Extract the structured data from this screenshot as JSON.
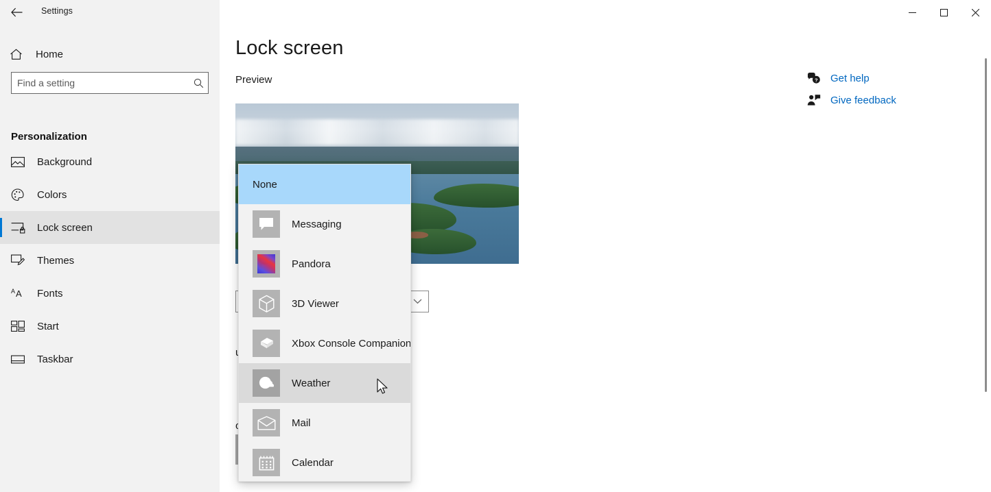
{
  "window": {
    "app_title": "Settings",
    "back_label": "←",
    "controls": {
      "minimize": "—",
      "maximize": "☐",
      "close": "✕"
    }
  },
  "sidebar": {
    "home_label": "Home",
    "search": {
      "value": "",
      "placeholder": "Find a setting",
      "icon": "search-icon"
    },
    "section_header": "Personalization",
    "items": [
      {
        "label": "Background",
        "icon": "image-icon",
        "selected": false
      },
      {
        "label": "Colors",
        "icon": "palette-icon",
        "selected": false
      },
      {
        "label": "Lock screen",
        "icon": "lock-screen-icon",
        "selected": true
      },
      {
        "label": "Themes",
        "icon": "brush-icon",
        "selected": false
      },
      {
        "label": "Fonts",
        "icon": "fonts-icon",
        "selected": false
      },
      {
        "label": "Start",
        "icon": "start-tiles-icon",
        "selected": false
      },
      {
        "label": "Taskbar",
        "icon": "taskbar-icon",
        "selected": false
      }
    ]
  },
  "main": {
    "page_title": "Lock screen",
    "preview_label": "Preview",
    "preview_image_alt": "Lake with forested islands aerial landscape",
    "status_text": "us on the lock screen",
    "quick_status_text": "on the lock screen",
    "app_tiles": [
      "+",
      "+"
    ],
    "combo_chevron": "⌄"
  },
  "help": {
    "items": [
      {
        "label": "Get help",
        "icon": "help-question-icon"
      },
      {
        "label": "Give feedback",
        "icon": "feedback-person-icon"
      }
    ]
  },
  "dropdown": {
    "options": [
      {
        "label": "None",
        "icon": "none-icon",
        "state": "selected"
      },
      {
        "label": "Messaging",
        "icon": "messaging-icon",
        "state": "normal"
      },
      {
        "label": "Pandora",
        "icon": "pandora-icon",
        "state": "normal"
      },
      {
        "label": "3D Viewer",
        "icon": "cube-icon",
        "state": "normal"
      },
      {
        "label": "Xbox Console Companion",
        "icon": "xbox-icon",
        "state": "normal"
      },
      {
        "label": "Weather",
        "icon": "weather-icon",
        "state": "hovered"
      },
      {
        "label": "Mail",
        "icon": "mail-icon",
        "state": "normal"
      },
      {
        "label": "Calendar",
        "icon": "calendar-icon",
        "state": "normal"
      }
    ]
  },
  "colors": {
    "accent": "#0078d4",
    "link": "#0067c0",
    "selected_option_bg": "#a8d8fb",
    "hovered_option_bg": "#dadada",
    "sidebar_bg": "#f2f2f2",
    "tile_bg": "#b3b3b3"
  }
}
